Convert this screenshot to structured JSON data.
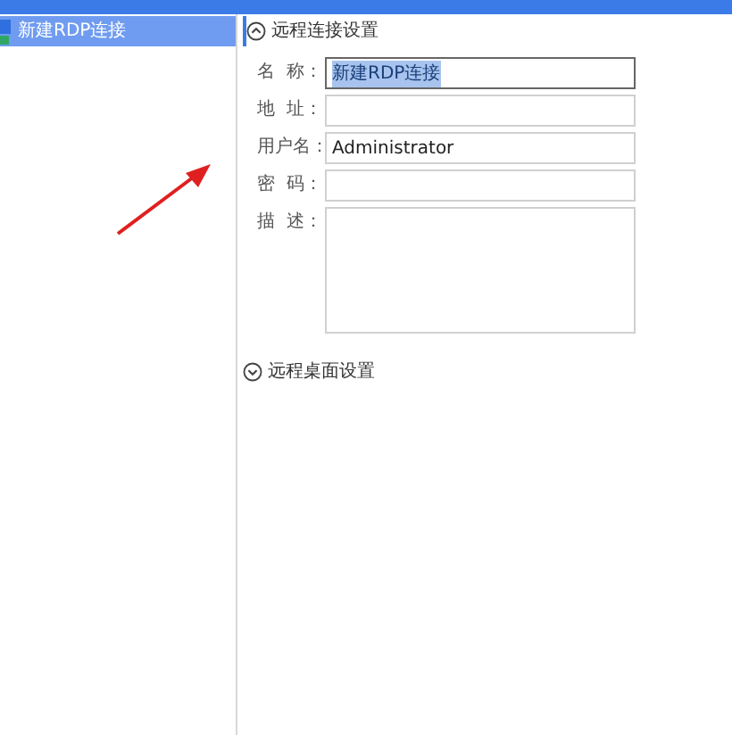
{
  "sidebar": {
    "items": [
      {
        "label": "新建RDP连接",
        "selected": true
      }
    ]
  },
  "sections": [
    {
      "title": "远程连接设置",
      "expanded": true,
      "fields": [
        {
          "kind": "input",
          "label": "名  称：",
          "value": "新建RDP连接",
          "text_selected": true,
          "focused": true
        },
        {
          "kind": "input",
          "label": "地  址：",
          "focused": false
        },
        {
          "kind": "input",
          "label": "用户名：",
          "value": "Administrator",
          "focused": false
        },
        {
          "kind": "input",
          "label": "密  码：",
          "focused": false
        },
        {
          "kind": "textarea",
          "label": "描  述：",
          "focused": false
        }
      ]
    },
    {
      "title": "远程桌面设置",
      "expanded": false
    }
  ]
}
